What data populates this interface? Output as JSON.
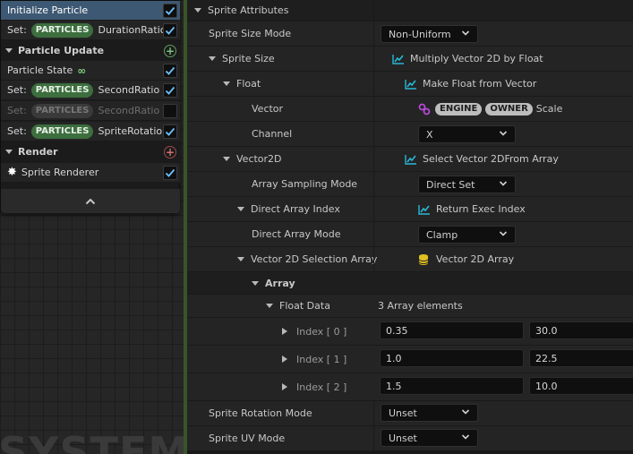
{
  "left_node": {
    "rows": [
      {
        "type": "selected",
        "label": "Initialize Particle",
        "checked": true
      },
      {
        "type": "set",
        "prefix": "Set:",
        "pill": "PARTICLES",
        "attr": "DurationRatio",
        "checked": true
      },
      {
        "type": "header",
        "label": "Particle Update",
        "button": "+"
      },
      {
        "type": "state",
        "label": "Particle State",
        "icon": "infinity-icon",
        "checked": true
      },
      {
        "type": "set",
        "prefix": "Set:",
        "pill": "PARTICLES",
        "attr": "SecondRatio",
        "checked": true
      },
      {
        "type": "set-disabled",
        "prefix": "Set:",
        "pill": "PARTICLES",
        "attr": "SecondRatio",
        "checked": false
      },
      {
        "type": "set",
        "prefix": "Set:",
        "pill": "PARTICLES",
        "attr": "SpriteRotation",
        "checked": true
      },
      {
        "type": "header",
        "label": "Render",
        "button": "+"
      },
      {
        "type": "renderer",
        "label": "Sprite Renderer",
        "icon": "sparkle-icon",
        "checked": true
      }
    ],
    "collapse_icon": "chevron-up-icon",
    "watermark": "SYSTEM"
  },
  "panel": {
    "section_title": "Sprite Attributes",
    "sprite_size_mode": {
      "label": "Sprite Size Mode",
      "value": "Non-Uniform"
    },
    "sprite_size": {
      "label": "Sprite Size",
      "value": "Multiply Vector 2D by Float"
    },
    "float": {
      "label": "Float",
      "value": "Make Float from Vector"
    },
    "vector": {
      "label": "Vector",
      "pill1": "ENGINE",
      "pill2": "OWNER",
      "suffix": "Scale"
    },
    "channel": {
      "label": "Channel",
      "value": "X"
    },
    "vector2d": {
      "label": "Vector2D",
      "value": "Select Vector 2DFrom Array"
    },
    "array_sampling_mode": {
      "label": "Array Sampling Mode",
      "value": "Direct Set"
    },
    "direct_array_index": {
      "label": "Direct Array Index",
      "value": "Return Exec Index"
    },
    "direct_array_mode": {
      "label": "Direct Array Mode",
      "value": "Clamp"
    },
    "selection_array": {
      "label": "Vector 2D Selection Array",
      "value": "Vector 2D Array"
    },
    "array": {
      "label": "Array"
    },
    "float_data": {
      "label": "Float Data",
      "value": "3 Array elements"
    },
    "elements": [
      {
        "label": "Index [ 0 ]",
        "x": "0.35",
        "y": "30.0"
      },
      {
        "label": "Index [ 1 ]",
        "x": "1.0",
        "y": "22.5"
      },
      {
        "label": "Index [ 2 ]",
        "x": "1.5",
        "y": "10.0"
      }
    ],
    "sprite_rotation_mode": {
      "label": "Sprite Rotation Mode",
      "value": "Unset"
    },
    "sprite_uv_mode": {
      "label": "Sprite UV Mode",
      "value": "Unset"
    }
  },
  "colors": {
    "accent_green": "#3c6e3e",
    "selected_blue": "#3d5873",
    "function_icon": "#29b6d6",
    "array_icon": "#e0c020",
    "link_icon": "#b24ad6"
  }
}
